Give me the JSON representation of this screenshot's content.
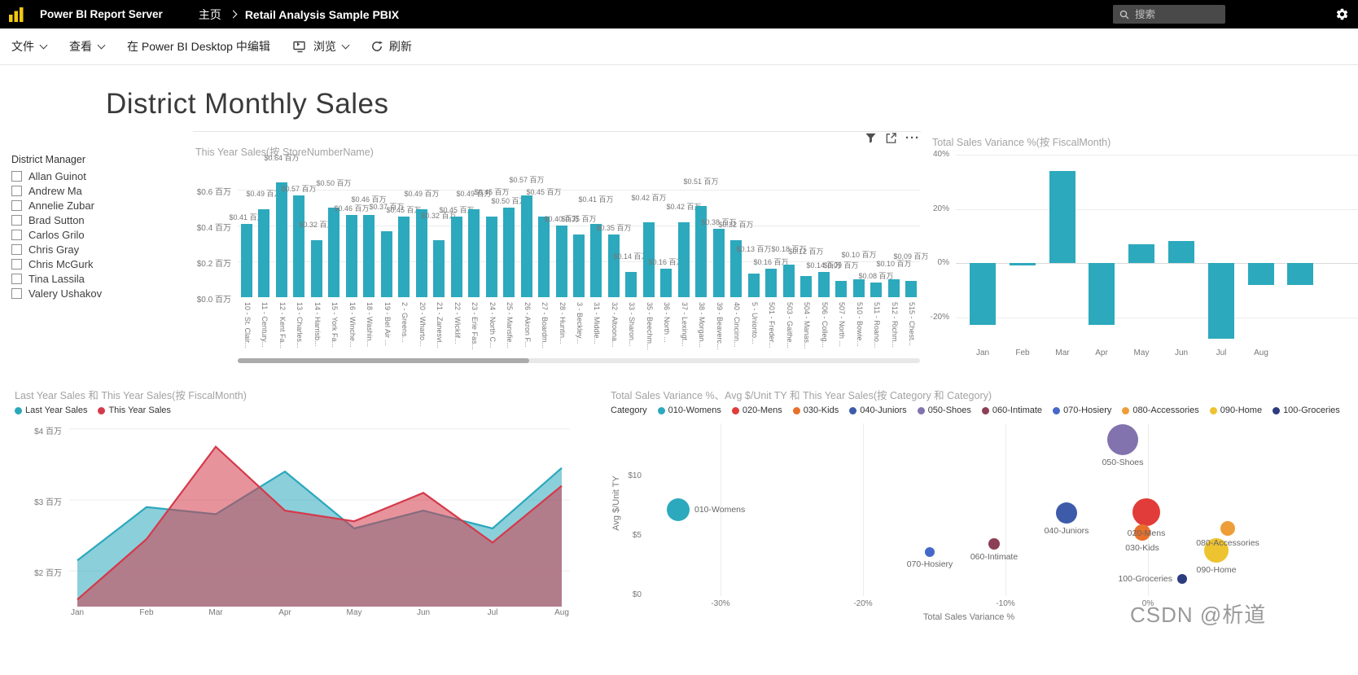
{
  "header": {
    "brand": "Power BI Report Server",
    "breadcrumb": {
      "home": "主页",
      "current": "Retail Analysis Sample PBIX"
    },
    "search_placeholder": "搜索"
  },
  "toolbar": {
    "file": "文件",
    "view": "查看",
    "edit_in_desktop": "在 Power BI Desktop 中编辑",
    "browse": "浏览",
    "refresh": "刷新"
  },
  "report": {
    "title": "District Monthly Sales"
  },
  "slicer": {
    "title": "District Manager",
    "options": [
      "Allan Guinot",
      "Andrew Ma",
      "Annelie Zubar",
      "Brad Sutton",
      "Carlos Grilo",
      "Chris Gray",
      "Chris McGurk",
      "Tina Lassila",
      "Valery Ushakov"
    ]
  },
  "icons": {
    "ellipsis": "···"
  },
  "watermark": "CSDN @析道",
  "chart_data": [
    {
      "id": "this-year-sales-by-store",
      "type": "bar",
      "title": "This Year Sales(按 StoreNumberName)",
      "y_ticks": [
        "$0.6 百万",
        "$0.4 百万",
        "$0.2 百万",
        "$0.0 百万"
      ],
      "ylim": [
        0,
        0.7
      ],
      "bar_color": "#2CA9BD",
      "label_prefix": "$",
      "label_suffix": " 百万",
      "categories": [
        "10 - St. Clair...",
        "11 - Century...",
        "12 - Kent Fa...",
        "13 - Charles...",
        "14 - Harrisb...",
        "15 - York Fa...",
        "16 - Winche...",
        "18 - Washin...",
        "19 - Bel Air ...",
        "2 - Greens...",
        "20 - Wharto...",
        "21 - Zanesvi...",
        "22 - Wicklif...",
        "23 - Erie Fas...",
        "24 - North C...",
        "25 - Mansfie...",
        "26 - Akron F...",
        "27 - Boardm...",
        "28 - Huntin...",
        "3 - Beckley...",
        "31 - Middle...",
        "32 - Altoona...",
        "33 - Sharon...",
        "35 - Beechm...",
        "36 - North ...",
        "37 - Lexingt...",
        "38 - Morgan...",
        "39 - Beaverc...",
        "40 - Cincinn...",
        "5 - Unionto...",
        "501 - Freder...",
        "503 - Gaithe...",
        "504 - Manas...",
        "506 - Colleg...",
        "507 - North ...",
        "510 - Bowie...",
        "511 - Roano...",
        "512 - Richm...",
        "515 - Chest..."
      ],
      "values": [
        0.41,
        0.49,
        0.64,
        0.57,
        0.32,
        0.5,
        0.46,
        0.46,
        0.37,
        0.45,
        0.49,
        0.32,
        0.45,
        0.49,
        0.45,
        0.5,
        0.57,
        0.45,
        0.4,
        0.35,
        0.41,
        0.35,
        0.14,
        0.42,
        0.16,
        0.42,
        0.51,
        0.38,
        0.32,
        0.13,
        0.16,
        0.18,
        0.12,
        0.14,
        0.09,
        0.1,
        0.08,
        0.1,
        0.09
      ]
    },
    {
      "id": "total-sales-variance-by-fiscalmonth",
      "type": "bar",
      "title": "Total Sales Variance %(按 FiscalMonth)",
      "y_ticks": [
        "40%",
        "20%",
        "0%",
        "-20%"
      ],
      "ylim": [
        -30,
        45
      ],
      "bar_color": "#2CA9BD",
      "categories": [
        "Jan",
        "Feb",
        "Mar",
        "Apr",
        "May",
        "Jun",
        "Jul",
        "Aug"
      ],
      "values": [
        -23,
        -1,
        34,
        -23,
        7,
        8,
        -28,
        -8
      ],
      "clipped_bar_value": -8
    },
    {
      "id": "last-year-vs-this-year-sales",
      "type": "area",
      "title": "Last Year Sales 和 This Year Sales(按 FiscalMonth)",
      "y_ticks": [
        "$4 百万",
        "$3 百万",
        "$2 百万"
      ],
      "y_tick_values": [
        4,
        3,
        2
      ],
      "ylim": [
        1.5,
        4.1
      ],
      "categories": [
        "Jan",
        "Feb",
        "Mar",
        "Apr",
        "May",
        "Jun",
        "Jul",
        "Aug"
      ],
      "series": [
        {
          "name": "Last Year Sales",
          "color": "#2BA8BC",
          "values": [
            2.15,
            2.9,
            2.8,
            3.4,
            2.6,
            2.85,
            2.6,
            3.45
          ]
        },
        {
          "name": "This Year Sales",
          "color": "#D43A4B",
          "values": [
            1.6,
            2.45,
            3.75,
            2.85,
            2.7,
            3.1,
            2.4,
            3.2
          ]
        }
      ]
    },
    {
      "id": "variance-avg-unit-by-category",
      "type": "scatter",
      "title": "Total Sales Variance %、Avg $/Unit TY 和 This Year Sales(按 Category 和 Category)",
      "legend_title": "Category",
      "xlabel": "Total Sales Variance %",
      "ylabel": "Avg $/Unit TY",
      "x_ticks": [
        "-30%",
        "-20%",
        "-10%",
        "0%"
      ],
      "x_tick_values": [
        -30,
        -20,
        -10,
        0
      ],
      "y_ticks": [
        "$10",
        "$5",
        "$0"
      ],
      "y_tick_values": [
        10,
        5,
        0
      ],
      "xlim": [
        -37,
        14.7
      ],
      "ylim": [
        0,
        14.5
      ],
      "points": [
        {
          "category": "010-Womens",
          "color": "#2CA9BD",
          "x": -33,
          "y": 7.2,
          "r": 14,
          "label_side": "right"
        },
        {
          "category": "020-Mens",
          "color": "#E13C39",
          "x": -0.1,
          "y": 7.0,
          "r": 17,
          "label_side": "below"
        },
        {
          "category": "030-Kids",
          "color": "#E8702A",
          "x": -0.4,
          "y": 5.3,
          "r": 10,
          "label_side": "below"
        },
        {
          "category": "040-Juniors",
          "color": "#3D5BA9",
          "x": -5.7,
          "y": 6.9,
          "r": 13,
          "label_side": "below"
        },
        {
          "category": "050-Shoes",
          "color": "#8273AE",
          "x": -1.8,
          "y": 13.1,
          "r": 19,
          "label_side": "below"
        },
        {
          "category": "060-Intimate",
          "color": "#8C3F55",
          "x": -10.8,
          "y": 4.3,
          "r": 7,
          "label_side": "below"
        },
        {
          "category": "070-Hosiery",
          "color": "#4668C8",
          "x": -15.3,
          "y": 3.6,
          "r": 6,
          "label_side": "below"
        },
        {
          "category": "080-Accessories",
          "color": "#EE9E38",
          "x": 5.6,
          "y": 5.6,
          "r": 9,
          "label_side": "below"
        },
        {
          "category": "090-Home",
          "color": "#EDC32F",
          "x": 4.8,
          "y": 3.8,
          "r": 15,
          "label_side": "below"
        },
        {
          "category": "100-Groceries",
          "color": "#2C3C7E",
          "x": 2.4,
          "y": 1.4,
          "r": 6,
          "label_side": "left"
        }
      ]
    }
  ]
}
